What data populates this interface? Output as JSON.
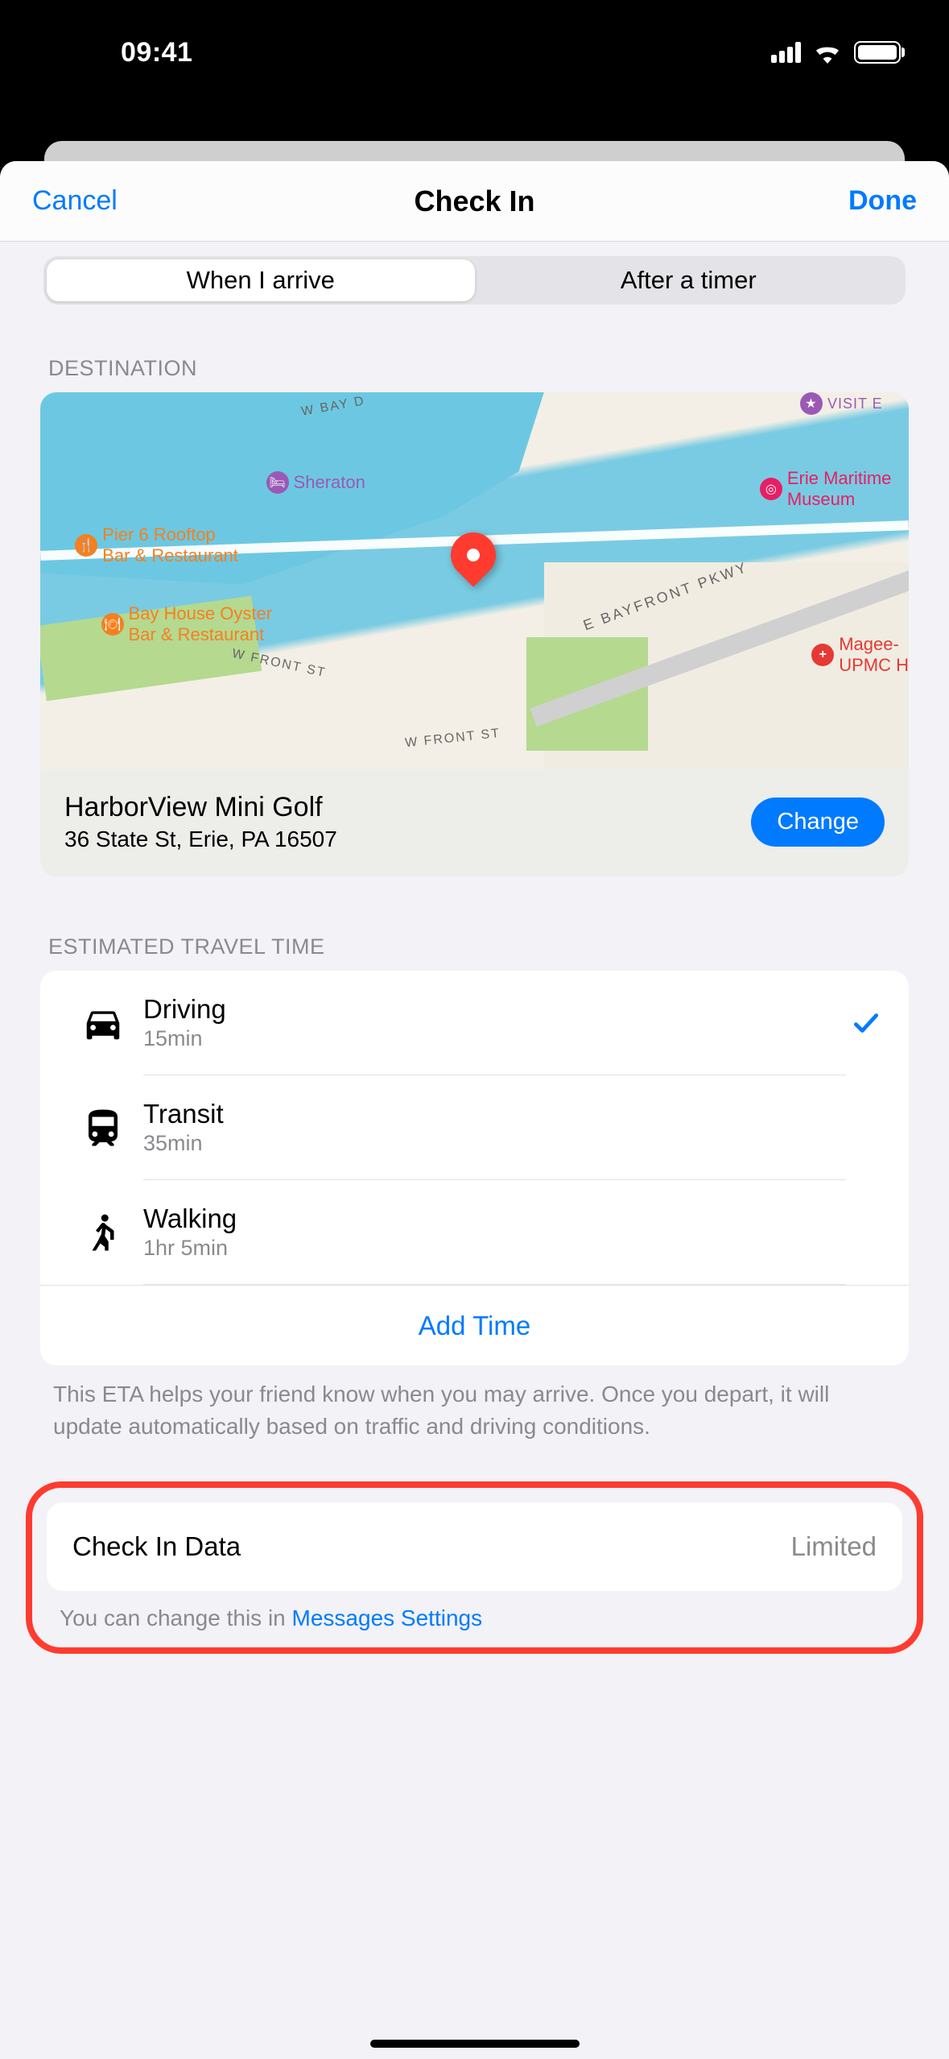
{
  "status": {
    "time": "09:41"
  },
  "nav": {
    "cancel": "Cancel",
    "title": "Check In",
    "done": "Done"
  },
  "segments": {
    "arrive": "When I arrive",
    "timer": "After a timer"
  },
  "sections": {
    "destination_label": "DESTINATION",
    "travel_label": "ESTIMATED TRAVEL TIME"
  },
  "destination": {
    "name": "HarborView Mini Golf",
    "address": "36 State St, Erie, PA  16507",
    "change_label": "Change"
  },
  "map_pois": {
    "sheraton": "Sheraton",
    "pier6_l1": "Pier 6 Rooftop",
    "pier6_l2": "Bar & Restaurant",
    "bayhouse_l1": "Bay House Oyster",
    "bayhouse_l2": "Bar & Restaurant",
    "erie_l1": "Erie Maritime",
    "erie_l2": "Museum",
    "magee_l1": "Magee-",
    "magee_l2": "UPMC H",
    "visit": "VISIT E",
    "road1": "E BAYFRONT PKWY",
    "road2": "W FRONT ST",
    "road3": "W FRONT ST",
    "road4": "W BAY D"
  },
  "travel": {
    "driving": {
      "label": "Driving",
      "time": "15min",
      "selected": true
    },
    "transit": {
      "label": "Transit",
      "time": "35min",
      "selected": false
    },
    "walking": {
      "label": "Walking",
      "time": "1hr 5min",
      "selected": false
    },
    "add_time": "Add Time",
    "footer": "This ETA helps your friend know when you may arrive. Once you depart, it will update automatically based on traffic and driving conditions."
  },
  "checkin_data": {
    "label": "Check In Data",
    "value": "Limited",
    "footer_prefix": "You can change this in ",
    "footer_link": "Messages Settings"
  }
}
